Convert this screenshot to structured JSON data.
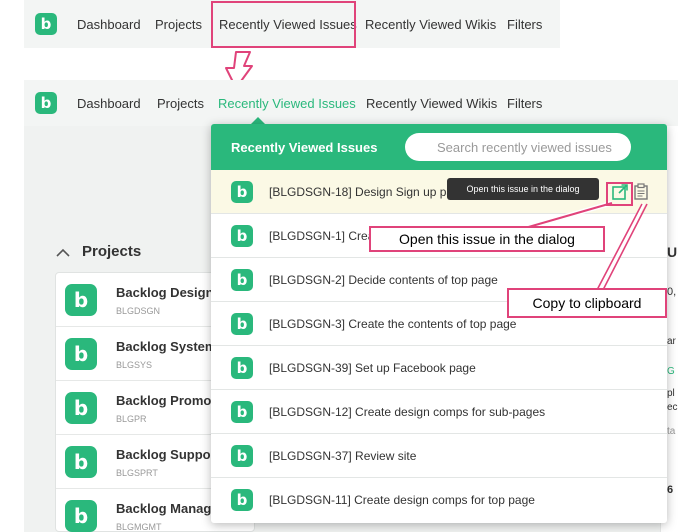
{
  "top_nav": {
    "logo": "b",
    "items": [
      "Dashboard",
      "Projects",
      "Recently Viewed Issues",
      "Recently Viewed Wikis",
      "Filters"
    ]
  },
  "nav": {
    "logo": "b",
    "items": [
      "Dashboard",
      "Projects",
      "Recently Viewed Issues",
      "Recently Viewed Wikis",
      "Filters"
    ]
  },
  "projects": {
    "header": "Projects",
    "items": [
      {
        "name": "Backlog Design",
        "key": "BLGDSGN"
      },
      {
        "name": "Backlog System",
        "key": "BLGSYS"
      },
      {
        "name": "Backlog Promo",
        "key": "BLGPR"
      },
      {
        "name": "Backlog Suppor",
        "key": "BLGSPRT"
      },
      {
        "name": "Backlog Manag",
        "key": "BLGMGMT"
      }
    ]
  },
  "right_panel": {
    "fragments": [
      "U",
      "0,",
      "ar",
      "G",
      "pl",
      "ec",
      "ta",
      "6"
    ]
  },
  "dropdown": {
    "title": "Recently Viewed Issues",
    "search_placeholder": "Search recently viewed issues",
    "issues": [
      "[BLGDSGN-18] Design Sign up page",
      "[BLGDSGN-1] Create",
      "[BLGDSGN-2] Decide contents of top page",
      "[BLGDSGN-3] Create the contents of top page",
      "[BLGDSGN-39] Set up Facebook page",
      "[BLGDSGN-12] Create design comps for sub-pages",
      "[BLGDSGN-37] Review site",
      "[BLGDSGN-11] Create design comps for top page"
    ]
  },
  "tooltip": "Open this issue in the dialog",
  "callouts": {
    "open": "Open this issue in the dialog",
    "copy": "Copy to clipboard"
  },
  "colors": {
    "brand": "#2ab87c",
    "annotation": "#e0437a",
    "highlight_row": "#fbf9e5"
  }
}
